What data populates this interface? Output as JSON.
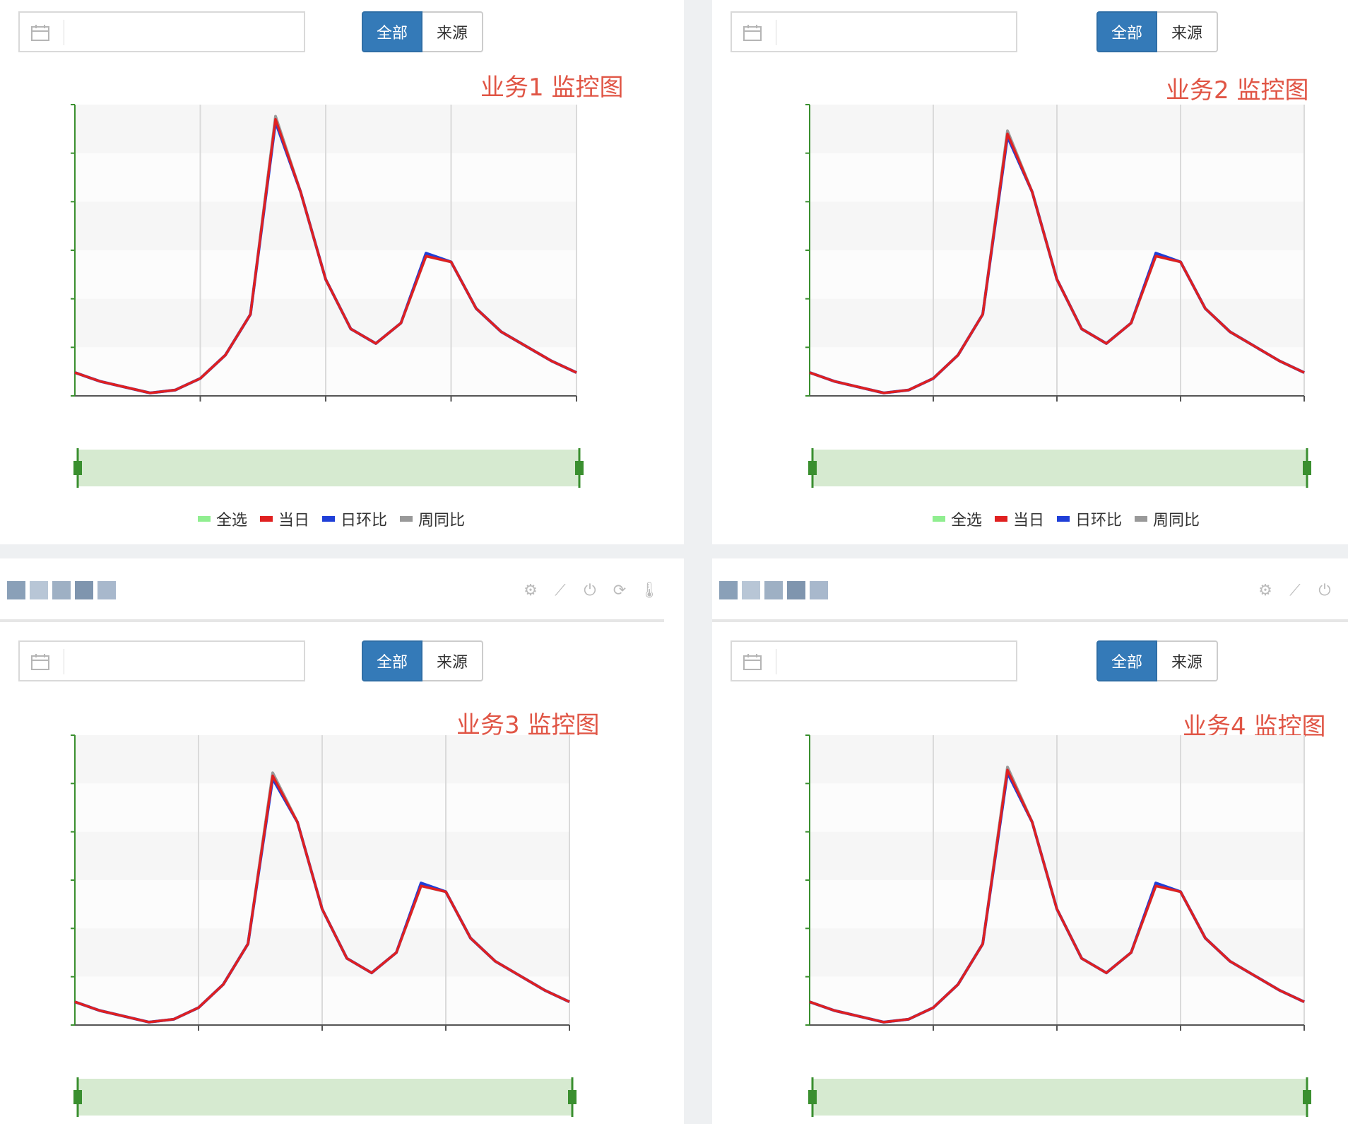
{
  "toolbar": {
    "all_label": "全部",
    "source_label": "来源",
    "date_value": ""
  },
  "legend": {
    "items": [
      {
        "label": "全选",
        "color": "#90ee90"
      },
      {
        "label": "当日",
        "color": "#e02020"
      },
      {
        "label": "日环比",
        "color": "#1f3fd8"
      },
      {
        "label": "周同比",
        "color": "#999999"
      }
    ]
  },
  "panels": [
    {
      "title": "业务1 监控图"
    },
    {
      "title": "业务2 监控图"
    },
    {
      "title": "业务3 监控图"
    },
    {
      "title": "业务4 监控图"
    }
  ],
  "colors": {
    "accent": "#347ab8",
    "title_red": "#e05545",
    "axis_green": "#3a8f2f",
    "zoom_fill": "#d6ead0"
  },
  "icons": [
    "calendar-icon",
    "gear-icon",
    "line-chart-icon",
    "power-icon",
    "refresh-icon",
    "thermometer-icon"
  ],
  "chart_data": [
    {
      "type": "line",
      "title": "业务1 监控图",
      "x": [
        0,
        5,
        10,
        15,
        20,
        25,
        30,
        35,
        40,
        45,
        50,
        55,
        60,
        65,
        70,
        75,
        80,
        85,
        90,
        95,
        100
      ],
      "series": [
        {
          "name": "当日",
          "values": [
            8,
            5,
            3,
            1,
            2,
            6,
            14,
            28,
            95,
            70,
            40,
            23,
            18,
            25,
            48,
            46,
            30,
            22,
            17,
            12,
            8
          ]
        },
        {
          "name": "日环比",
          "values": [
            8,
            5,
            3,
            1,
            2,
            6,
            14,
            28,
            94,
            70,
            40,
            23,
            18,
            25,
            49,
            46,
            30,
            22,
            17,
            12,
            8
          ]
        },
        {
          "name": "周同比",
          "values": [
            8,
            5,
            3,
            1,
            2,
            6,
            14,
            28,
            96,
            70,
            40,
            23,
            18,
            25,
            48,
            46,
            30,
            22,
            17,
            12,
            8
          ]
        }
      ]
    },
    {
      "type": "line",
      "title": "业务2 监控图",
      "x": [
        0,
        5,
        10,
        15,
        20,
        25,
        30,
        35,
        40,
        45,
        50,
        55,
        60,
        65,
        70,
        75,
        80,
        85,
        90,
        95,
        100
      ],
      "series": [
        {
          "name": "当日",
          "values": [
            8,
            5,
            3,
            1,
            2,
            6,
            14,
            28,
            90,
            70,
            40,
            23,
            18,
            25,
            48,
            46,
            30,
            22,
            17,
            12,
            8
          ]
        },
        {
          "name": "日环比",
          "values": [
            8,
            5,
            3,
            1,
            2,
            6,
            14,
            28,
            89,
            70,
            40,
            23,
            18,
            25,
            49,
            46,
            30,
            22,
            17,
            12,
            8
          ]
        },
        {
          "name": "周同比",
          "values": [
            8,
            5,
            3,
            1,
            2,
            6,
            14,
            28,
            91,
            70,
            40,
            23,
            18,
            25,
            48,
            46,
            30,
            22,
            17,
            12,
            8
          ]
        }
      ]
    },
    {
      "type": "line",
      "title": "业务3 监控图",
      "x": [
        0,
        5,
        10,
        15,
        20,
        25,
        30,
        35,
        40,
        45,
        50,
        55,
        60,
        65,
        70,
        75,
        80,
        85,
        90,
        95,
        100
      ],
      "series": [
        {
          "name": "当日",
          "values": [
            8,
            5,
            3,
            1,
            2,
            6,
            14,
            28,
            86,
            70,
            40,
            23,
            18,
            25,
            48,
            46,
            30,
            22,
            17,
            12,
            8
          ]
        },
        {
          "name": "日环比",
          "values": [
            8,
            5,
            3,
            1,
            2,
            6,
            14,
            28,
            85,
            70,
            40,
            23,
            18,
            25,
            49,
            46,
            30,
            22,
            17,
            12,
            8
          ]
        },
        {
          "name": "周同比",
          "values": [
            8,
            5,
            3,
            1,
            2,
            6,
            14,
            28,
            87,
            70,
            40,
            23,
            18,
            25,
            48,
            46,
            30,
            22,
            17,
            12,
            8
          ]
        }
      ]
    },
    {
      "type": "line",
      "title": "业务4 监控图",
      "x": [
        0,
        5,
        10,
        15,
        20,
        25,
        30,
        35,
        40,
        45,
        50,
        55,
        60,
        65,
        70,
        75,
        80,
        85,
        90,
        95,
        100
      ],
      "series": [
        {
          "name": "当日",
          "values": [
            8,
            5,
            3,
            1,
            2,
            6,
            14,
            28,
            88,
            70,
            40,
            23,
            18,
            25,
            48,
            46,
            30,
            22,
            17,
            12,
            8
          ]
        },
        {
          "name": "日环比",
          "values": [
            8,
            5,
            3,
            1,
            2,
            6,
            14,
            28,
            87,
            70,
            40,
            23,
            18,
            25,
            49,
            46,
            30,
            22,
            17,
            12,
            8
          ]
        },
        {
          "name": "周同比",
          "values": [
            8,
            5,
            3,
            1,
            2,
            6,
            14,
            28,
            89,
            70,
            40,
            23,
            18,
            25,
            48,
            46,
            30,
            22,
            17,
            12,
            8
          ]
        }
      ]
    }
  ]
}
